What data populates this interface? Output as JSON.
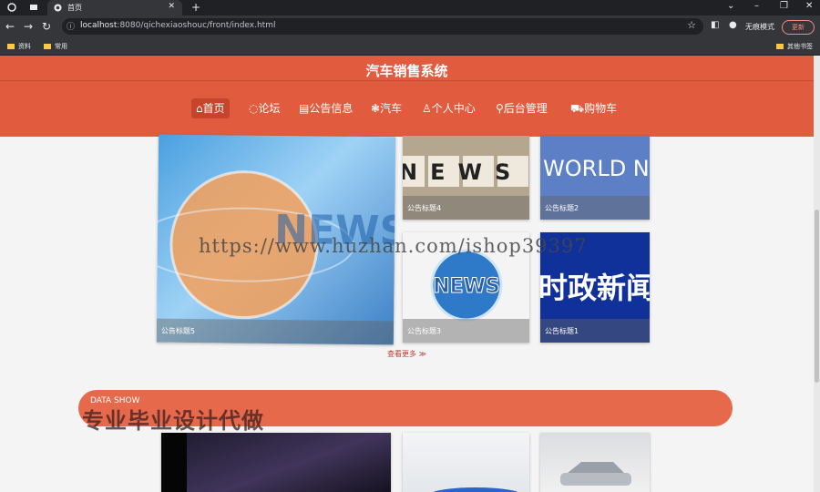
{
  "browser": {
    "tab_title": "首页",
    "url_host": "localhost",
    "url_rest": ":8080/qichexiaoshouc/front/index.html",
    "incognito_label": "无痕模式",
    "update_label": "更新",
    "bookmarks": [
      "资料",
      "常用"
    ],
    "other_bookmarks": "其他书签"
  },
  "site": {
    "title": "汽车销售系统",
    "nav": [
      {
        "icon": "⌂",
        "label": "首页"
      },
      {
        "icon": "◌",
        "label": "论坛"
      },
      {
        "icon": "▤",
        "label": "公告信息"
      },
      {
        "icon": "❃",
        "label": "汽车"
      },
      {
        "icon": "♙",
        "label": "个人中心"
      },
      {
        "icon": "⚲",
        "label": "后台管理"
      },
      {
        "icon": "⛟",
        "label": "购物车"
      }
    ]
  },
  "announcements": [
    {
      "label": "公告标题5",
      "art": "NEWS"
    },
    {
      "label": "公告标题4",
      "art": "NEWS"
    },
    {
      "label": "公告标题2",
      "art": "BBC WORLD NEWS"
    },
    {
      "label": "公告标题3",
      "art": "NEWS"
    },
    {
      "label": "公告标题1",
      "art": "时政新闻"
    }
  ],
  "more_label": "查看更多 ≫",
  "section_title": "DATA SHOW",
  "watermarks": {
    "url": "https://www.huzhan.com/ishop39397",
    "text": "专业毕业设计代做"
  },
  "colors": {
    "accent": "#e15c3f",
    "nav_active": "#c7432b"
  }
}
